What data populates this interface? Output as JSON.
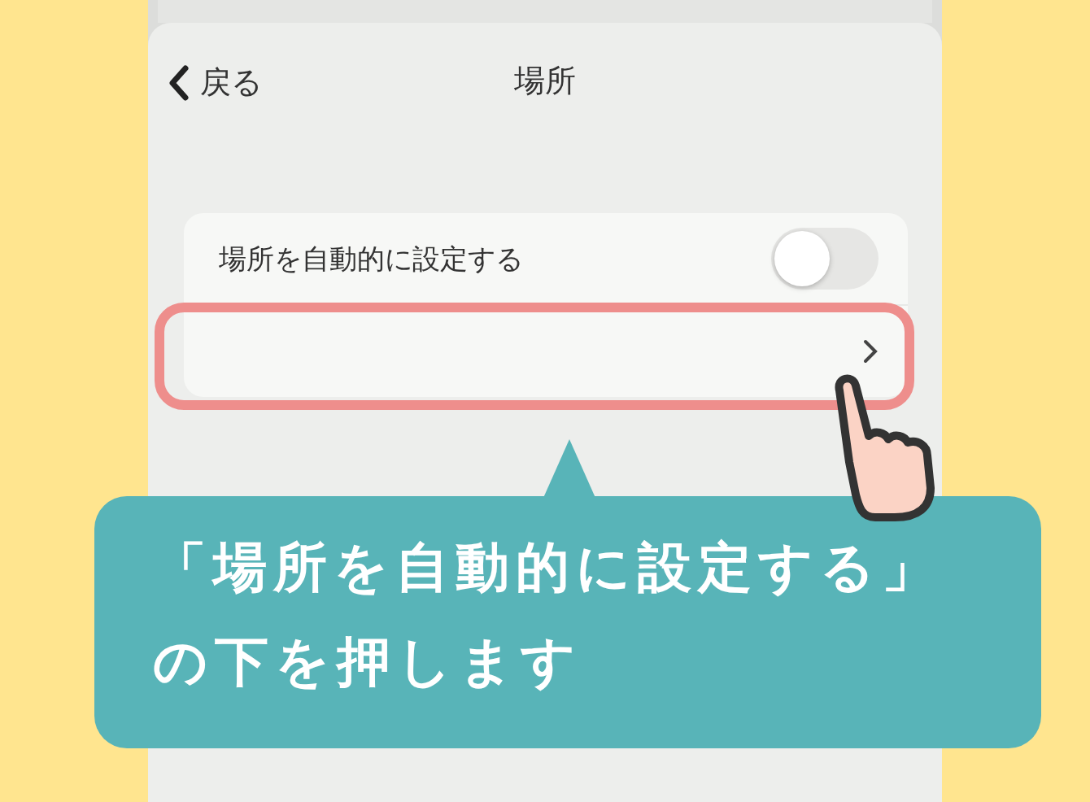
{
  "nav": {
    "back_label": "戻る",
    "title": "場所"
  },
  "settings": [
    {
      "kind": "toggle",
      "label": "場所を自動的に設定する",
      "on": false,
      "highlighted": false
    },
    {
      "kind": "link",
      "highlighted": true
    }
  ],
  "callout": {
    "lines": [
      "「場所を自動的に設定する」",
      "の下を押します"
    ]
  }
}
